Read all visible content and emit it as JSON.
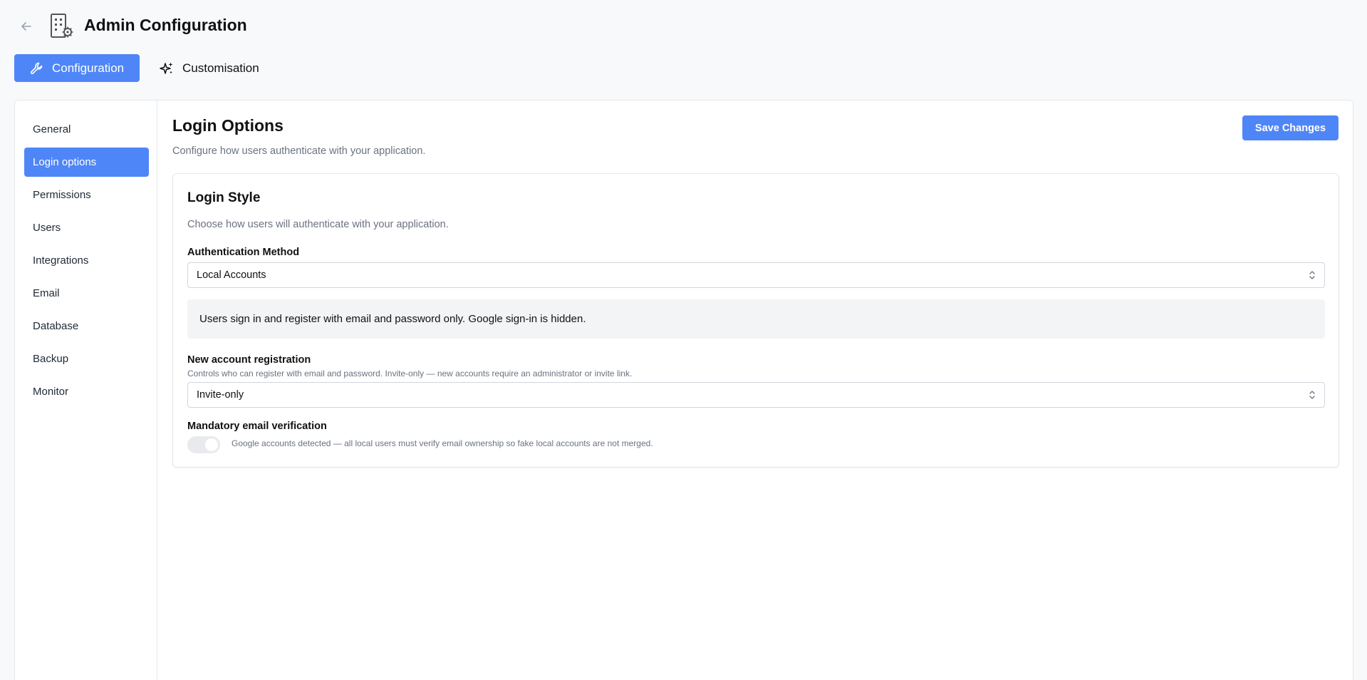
{
  "header": {
    "back_icon": "arrow-left-icon",
    "app_icon": "building-gear-icon",
    "title": "Admin Configuration"
  },
  "tabs": [
    {
      "label": "Configuration",
      "icon": "wrench-icon",
      "active": true
    },
    {
      "label": "Customisation",
      "icon": "sparkles-icon",
      "active": false
    }
  ],
  "sidebar": {
    "items": [
      {
        "label": "General"
      },
      {
        "label": "Login options",
        "active": true
      },
      {
        "label": "Permissions"
      },
      {
        "label": "Users"
      },
      {
        "label": "Integrations"
      },
      {
        "label": "Email"
      },
      {
        "label": "Database"
      },
      {
        "label": "Backup"
      },
      {
        "label": "Monitor"
      }
    ]
  },
  "main": {
    "title": "Login Options",
    "subtitle": "Configure how users authenticate with your application.",
    "save_label": "Save Changes",
    "card": {
      "title": "Login Style",
      "subtitle": "Choose how users will authenticate with your application.",
      "auth_method": {
        "label": "Authentication Method",
        "value": "Local Accounts"
      },
      "info": "Users sign in and register with email and password only. Google sign-in is hidden.",
      "registration": {
        "label": "New account registration",
        "help": "Controls who can register with email and password. Invite-only — new accounts require an administrator or invite link.",
        "value": "Invite-only"
      },
      "verification": {
        "label": "Mandatory email verification",
        "help": "Google accounts detected — all local users must verify email ownership so fake local accounts are not merged.",
        "enabled": true,
        "disabled": true
      }
    }
  },
  "colors": {
    "accent": "#4f86f7",
    "background": "#f8f9fb",
    "muted_text": "#6b7280"
  }
}
